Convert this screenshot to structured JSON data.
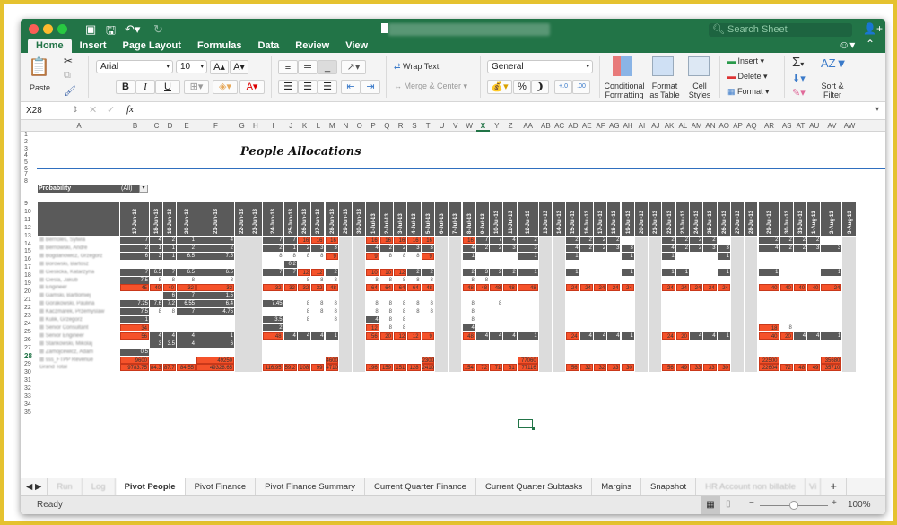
{
  "window": {
    "doc_title": "High account tracker 28.06.13",
    "search_placeholder": "Search Sheet"
  },
  "ribbon_tabs": [
    "Home",
    "Insert",
    "Page Layout",
    "Formulas",
    "Data",
    "Review",
    "View"
  ],
  "ribbon": {
    "paste": "Paste",
    "font_name": "Arial",
    "font_size": "10",
    "bold": "B",
    "italic": "I",
    "underline": "U",
    "wrap_text": "Wrap Text",
    "merge_center": "Merge & Center",
    "number_format": "General",
    "percent": "%",
    "conditional_formatting": [
      "Conditional",
      "Formatting"
    ],
    "format_as_table": [
      "Format",
      "as Table"
    ],
    "cell_styles": [
      "Cell",
      "Styles"
    ],
    "insert": "Insert",
    "delete": "Delete",
    "format": "Format",
    "sort_filter": [
      "Sort &",
      "Filter"
    ],
    "sigma": "Σ"
  },
  "formula_bar": {
    "name_box": "X28",
    "fx": "fx",
    "value": ""
  },
  "columns": [
    "A",
    "B",
    "C",
    "D",
    "E",
    "F",
    "G",
    "H",
    "I",
    "J",
    "K",
    "L",
    "M",
    "N",
    "O",
    "P",
    "Q",
    "R",
    "S",
    "T",
    "U",
    "V",
    "W",
    "X",
    "Y",
    "Z",
    "AA",
    "AB",
    "AC",
    "AD",
    "AE",
    "AF",
    "AG",
    "AH",
    "AI",
    "AJ",
    "AK",
    "AL",
    "AM",
    "AN",
    "AO",
    "AP",
    "AQ",
    "AR",
    "AS",
    "AT",
    "AU",
    "AV",
    "AW"
  ],
  "selected_column": "X",
  "selected_row": "28",
  "rows": [
    "1",
    "2",
    "3",
    "4",
    "5",
    "6",
    "7",
    "8",
    "9",
    "10",
    "11",
    "12",
    "13",
    "14",
    "15",
    "16",
    "17",
    "18",
    "19",
    "20",
    "21",
    "22",
    "23",
    "24",
    "25",
    "26",
    "27",
    "28",
    "29",
    "30",
    "31",
    "32",
    "33",
    "34",
    "35"
  ],
  "sheet": {
    "title": "People Allocations",
    "filter_label": "Probability",
    "filter_value": "(All)",
    "dates": [
      "17-Jun-13",
      "18-Jun-13",
      "19-Jun-13",
      "20-Jun-13",
      "21-Jun-13",
      "22-Jun-13",
      "23-Jun-13",
      "24-Jun-13",
      "25-Jun-13",
      "26-Jun-13",
      "27-Jun-13",
      "28-Jun-13",
      "29-Jun-13",
      "30-Jun-13",
      "1-Jul-13",
      "2-Jul-13",
      "3-Jul-13",
      "4-Jul-13",
      "5-Jul-13",
      "6-Jul-13",
      "7-Jul-13",
      "8-Jul-13",
      "9-Jul-13",
      "10-Jul-13",
      "11-Jul-13",
      "12-Jul-13",
      "13-Jul-13",
      "14-Jul-13",
      "15-Jul-13",
      "16-Jul-13",
      "17-Jul-13",
      "18-Jul-13",
      "19-Jul-13",
      "20-Jul-13",
      "21-Jul-13",
      "22-Jul-13",
      "23-Jul-13",
      "24-Jul-13",
      "25-Jul-13",
      "26-Jul-13",
      "27-Jul-13",
      "28-Jul-13",
      "29-Jul-13",
      "30-Jul-13",
      "31-Jul-13",
      "1-Aug-13",
      "2-Aug-13",
      "3-Aug-13"
    ],
    "row_labels": [
      "Bernoles, Sylwia",
      "Bernowski, Andre",
      "Bogdanowicz, Grzegorz",
      "Borowski, Bartosz",
      "Cieslicka, Katarzyna",
      "Ciesla, Jakub",
      "Engineer",
      "Gamski, Bartlomiej",
      "Gorakowski, Paulina",
      "Kaczmarek, Przemyslaw",
      "Kulik, Grzegorz",
      "Senior Consultant",
      "Senior Engineer",
      "Stankowski, Mikolaj",
      "Zamojcewicz, Adam",
      "sss_FTPP Revenue",
      "Grand Total"
    ],
    "data_rows": [
      {
        "v": [
          "7",
          "4",
          "2",
          "1",
          "4",
          "",
          "",
          "7",
          "7",
          "16",
          "16",
          "16",
          "",
          "",
          "16",
          "16",
          "16",
          "16",
          "16",
          "",
          "",
          "16",
          "7",
          "7",
          "4",
          "2",
          "",
          "",
          "2",
          "2",
          "2",
          "2",
          "",
          "",
          "",
          "2",
          "2",
          "2",
          "2",
          "",
          "",
          "",
          "2",
          "2",
          "2",
          "2",
          "",
          ""
        ],
        "o": [
          9,
          10,
          11,
          14,
          15,
          16,
          17,
          18,
          21
        ]
      },
      {
        "v": [
          "2",
          "1",
          "1",
          "2",
          "2",
          "",
          "",
          "2",
          "1",
          "2",
          "3",
          "3",
          "",
          "",
          "4",
          "2",
          "2",
          "3",
          "3",
          "",
          "",
          "4",
          "2",
          "2",
          "3",
          "3",
          "",
          "",
          "4",
          "2",
          "2",
          "3",
          "3",
          "",
          "",
          "4",
          "2",
          "2",
          "3",
          "3",
          "",
          "",
          "4",
          "2",
          "2",
          "3",
          "3",
          ""
        ],
        "o": []
      },
      {
        "v": [
          "6",
          "3",
          "1",
          "6.5",
          "7.5",
          "",
          "",
          "8",
          "8",
          "8",
          "8",
          "9",
          "",
          "",
          "9",
          "8",
          "8",
          "8",
          "9",
          "",
          "",
          "1",
          "",
          "",
          "",
          "1",
          "",
          "",
          "1",
          "",
          "",
          "",
          "1",
          "",
          "",
          "1",
          "",
          "",
          "",
          "1",
          "",
          "",
          "",
          "",
          "",
          "",
          "",
          ""
        ],
        "o": [
          11,
          14,
          18
        ]
      },
      {
        "v": [
          "",
          "",
          "",
          "",
          "",
          "",
          "",
          "",
          "0.2",
          "",
          "",
          "",
          "",
          "",
          "",
          "",
          "",
          "",
          "",
          "",
          "",
          "",
          "",
          "",
          "",
          "",
          "",
          "",
          "",
          "",
          "",
          "",
          "",
          "",
          "",
          "",
          "",
          "",
          "",
          "",
          "",
          "",
          "",
          "",
          "",
          "",
          "",
          ""
        ],
        "o": []
      },
      {
        "v": [
          "7",
          "6.5",
          "7",
          "6.5",
          "6.5",
          "",
          "",
          "7",
          "7",
          "12",
          "12",
          "2",
          "",
          "",
          "10",
          "10",
          "12",
          "2",
          "2",
          "",
          "",
          "2",
          "3",
          "2",
          "2",
          "1",
          "",
          "",
          "1",
          "",
          "",
          "",
          "1",
          "",
          "",
          "1",
          "1",
          "",
          "",
          "1",
          "",
          "",
          "1",
          "",
          "",
          "",
          "1",
          ""
        ],
        "o": [
          9,
          10,
          14,
          15,
          16
        ]
      },
      {
        "v": [
          "7.5",
          "8",
          "8",
          "8",
          "8",
          "",
          "",
          "",
          "",
          "8",
          "8",
          "8",
          "",
          "",
          "8",
          "8",
          "8",
          "8",
          "8",
          "",
          "",
          "8",
          "8",
          "",
          "",
          "",
          "",
          "",
          "",
          "",
          "",
          "",
          "",
          "",
          "",
          "",
          "",
          "",
          "",
          "",
          "",
          "",
          "",
          "",
          "",
          "",
          "",
          ""
        ],
        "o": []
      },
      {
        "v": [
          "45",
          "40",
          "40",
          "32",
          "32",
          "",
          "",
          "32",
          "32",
          "32",
          "32",
          "48",
          "",
          "",
          "64",
          "64",
          "64",
          "64",
          "48",
          "",
          "",
          "48",
          "48",
          "48",
          "48",
          "48",
          "",
          "",
          "24",
          "24",
          "24",
          "24",
          "24",
          "",
          "",
          "24",
          "24",
          "24",
          "24",
          "24",
          "",
          "",
          "40",
          "40",
          "40",
          "40",
          "24",
          ""
        ],
        "o": "all"
      },
      {
        "v": [
          "",
          "",
          "6",
          "7",
          "1.5",
          "",
          "",
          "",
          "",
          "",
          "",
          "",
          "",
          "",
          "",
          "",
          "",
          "",
          "",
          "",
          "",
          "",
          "",
          "",
          "",
          "",
          "",
          "",
          "",
          "",
          "",
          "",
          "",
          "",
          "",
          "",
          "",
          "",
          "",
          "",
          "",
          "",
          "",
          "",
          "",
          "",
          "",
          ""
        ],
        "o": []
      },
      {
        "v": [
          "7.25",
          "7.6",
          "7.2",
          "6.55",
          "6.4",
          "",
          "",
          "7.45",
          "",
          "8",
          "8",
          "8",
          "",
          "",
          "8",
          "8",
          "8",
          "8",
          "8",
          "",
          "",
          "8",
          "",
          "8",
          "",
          "",
          "",
          "",
          "",
          "",
          "",
          "",
          "",
          "",
          "",
          "",
          "",
          "",
          "",
          "",
          "",
          "",
          "",
          "",
          "",
          "",
          "",
          ""
        ],
        "o": []
      },
      {
        "v": [
          "7.5",
          "8",
          "8",
          "7",
          "4.75",
          "",
          "",
          "",
          "",
          "8",
          "8",
          "8",
          "",
          "",
          "8",
          "8",
          "8",
          "8",
          "8",
          "",
          "",
          "8",
          "",
          "",
          "",
          "",
          "",
          "",
          "",
          "",
          "",
          "",
          "",
          "",
          "",
          "",
          "",
          "",
          "",
          "",
          "",
          "",
          "",
          "",
          "",
          "",
          "",
          ""
        ],
        "o": []
      },
      {
        "v": [
          "1",
          "",
          "",
          "",
          "",
          "",
          "",
          "3.5",
          "",
          "8",
          "",
          "8",
          "",
          "",
          "4",
          "8",
          "8",
          "",
          "",
          "",
          "",
          "8",
          "",
          "",
          "",
          "",
          "",
          "",
          "",
          "",
          "",
          "",
          "",
          "",
          "",
          "",
          "",
          "",
          "",
          "",
          "",
          "",
          "",
          "",
          "",
          "",
          "",
          ""
        ],
        "o": []
      },
      {
        "v": [
          "34",
          "",
          "",
          "",
          "",
          "",
          "",
          "2",
          "",
          "",
          "",
          "",
          "",
          "",
          "12",
          "8",
          "8",
          "",
          "",
          "",
          "",
          "4",
          "",
          "",
          "",
          "",
          "",
          "",
          "",
          "",
          "",
          "",
          "",
          "",
          "",
          "",
          "",
          "",
          "",
          "",
          "",
          "",
          "18",
          "8",
          "",
          "",
          "",
          ""
        ],
        "o": [
          0,
          14,
          42
        ]
      },
      {
        "v": [
          "56",
          "4",
          "4",
          "4",
          "1",
          "",
          "",
          "48",
          "4",
          "4",
          "4",
          "1",
          "",
          "",
          "56",
          "20",
          "12",
          "12",
          "9",
          "",
          "",
          "48",
          "4",
          "4",
          "4",
          "1",
          "",
          "",
          "24",
          "4",
          "4",
          "4",
          "1",
          "",
          "",
          "24",
          "20",
          "4",
          "4",
          "1",
          "",
          "",
          "40",
          "20",
          "4",
          "4",
          "1",
          ""
        ],
        "o": [
          0,
          7,
          14,
          15,
          16,
          17,
          18,
          21,
          28,
          35,
          36,
          42,
          43
        ]
      },
      {
        "v": [
          "",
          "3",
          "3.5",
          "4",
          "6",
          "",
          "",
          "",
          "",
          "",
          "",
          "",
          "",
          "",
          "",
          "",
          "",
          "",
          "",
          "",
          "",
          "",
          "",
          "",
          "",
          "",
          "",
          "",
          "",
          "",
          "",
          "",
          "",
          "",
          "",
          "",
          "",
          "",
          "",
          "",
          "",
          "",
          "",
          "",
          "",
          "",
          "",
          ""
        ],
        "o": []
      },
      {
        "v": [
          "0.5",
          "",
          "",
          "",
          "",
          "",
          "",
          "",
          "",
          "",
          "",
          "",
          "",
          "",
          "",
          "",
          "",
          "",
          "",
          "",
          "",
          "",
          "",
          "",
          "",
          "",
          "",
          "",
          "",
          "",
          "",
          "",
          "",
          "",
          "",
          "",
          "",
          "",
          "",
          "",
          "",
          "",
          "",
          "",
          "",
          "",
          "",
          ""
        ],
        "o": []
      },
      {
        "v": [
          "9600",
          "",
          "",
          "",
          "49250",
          "",
          "",
          "",
          "",
          "",
          "",
          "4600",
          "",
          "",
          "",
          "",
          "",
          "",
          "2300",
          "",
          "",
          "",
          "",
          "",
          "",
          "77060",
          "",
          "",
          "",
          "",
          "",
          "",
          "",
          "",
          "",
          "",
          "",
          "",
          "",
          "",
          "",
          "",
          "22500",
          "",
          "",
          "",
          "35680",
          ""
        ],
        "o": [
          0,
          4,
          11,
          18,
          25,
          42,
          46
        ]
      },
      {
        "v": [
          "9783.75",
          "84.3",
          "87.7",
          "84.55",
          "49328.65",
          "",
          "",
          "116.95",
          "59.2",
          "108",
          "99",
          "4710",
          "",
          "",
          "196",
          "159",
          "151",
          "128",
          "2410",
          "",
          "",
          "154",
          "72",
          "71",
          "61",
          "77116",
          "",
          "",
          "56",
          "32",
          "32",
          "33",
          "30",
          "",
          "",
          "56",
          "49",
          "33",
          "33",
          "30",
          "",
          "",
          "22604",
          "72",
          "48",
          "49",
          "35710",
          ""
        ],
        "o": "all"
      }
    ]
  },
  "sheet_tabs": [
    "Run",
    "Log",
    "Pivot People",
    "Pivot Finance",
    "Pivot Finance Summary",
    "Current Quarter Finance",
    "Current Quarter Subtasks",
    "Margins",
    "Snapshot",
    "HR Account non billable",
    "Vi"
  ],
  "active_sheet_tab": "Pivot People",
  "status": {
    "ready": "Ready",
    "zoom": "100%",
    "zoom_fraction": 0.5
  }
}
